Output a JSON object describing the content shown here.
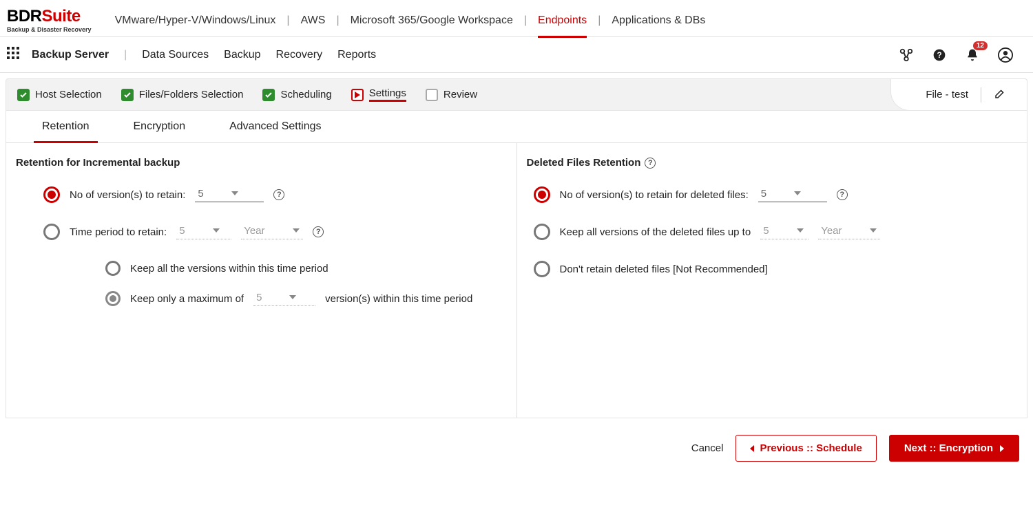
{
  "brand": {
    "name1": "BDR",
    "name2": "Suite",
    "tagline": "Backup & Disaster Recovery"
  },
  "topnav": {
    "items": [
      "VMware/Hyper-V/Windows/Linux",
      "AWS",
      "Microsoft 365/Google Workspace",
      "Endpoints",
      "Applications & DBs"
    ],
    "active": 3
  },
  "second": {
    "title": "Backup Server",
    "items": [
      "Data Sources",
      "Backup",
      "Recovery",
      "Reports"
    ],
    "badge": "12"
  },
  "wizard": {
    "steps": [
      {
        "label": "Host Selection",
        "state": "done"
      },
      {
        "label": "Files/Folders Selection",
        "state": "done"
      },
      {
        "label": "Scheduling",
        "state": "done"
      },
      {
        "label": "Settings",
        "state": "current"
      },
      {
        "label": "Review",
        "state": "pending"
      }
    ],
    "jobname": "File - test"
  },
  "subtabs": {
    "items": [
      "Retention",
      "Encryption",
      "Advanced Settings"
    ],
    "active": 0
  },
  "leftPanel": {
    "title": "Retention for Incremental backup",
    "opt1_label": "No of version(s) to retain:",
    "opt1_value": "5",
    "opt2_label": "Time period to retain:",
    "opt2_value": "5",
    "opt2_unit": "Year",
    "sub1_label": "Keep all the versions within this time period",
    "sub2_prefix": "Keep only a maximum of",
    "sub2_value": "5",
    "sub2_suffix": "version(s) within this time period"
  },
  "rightPanel": {
    "title": "Deleted Files Retention",
    "opt1_label": "No of version(s) to retain for deleted files:",
    "opt1_value": "5",
    "opt2_label": "Keep all versions of the deleted files up to",
    "opt2_value": "5",
    "opt2_unit": "Year",
    "opt3_label": "Don't retain deleted files [Not Recommended]"
  },
  "footer": {
    "cancel": "Cancel",
    "prev": "Previous :: Schedule",
    "next": "Next :: Encryption"
  }
}
